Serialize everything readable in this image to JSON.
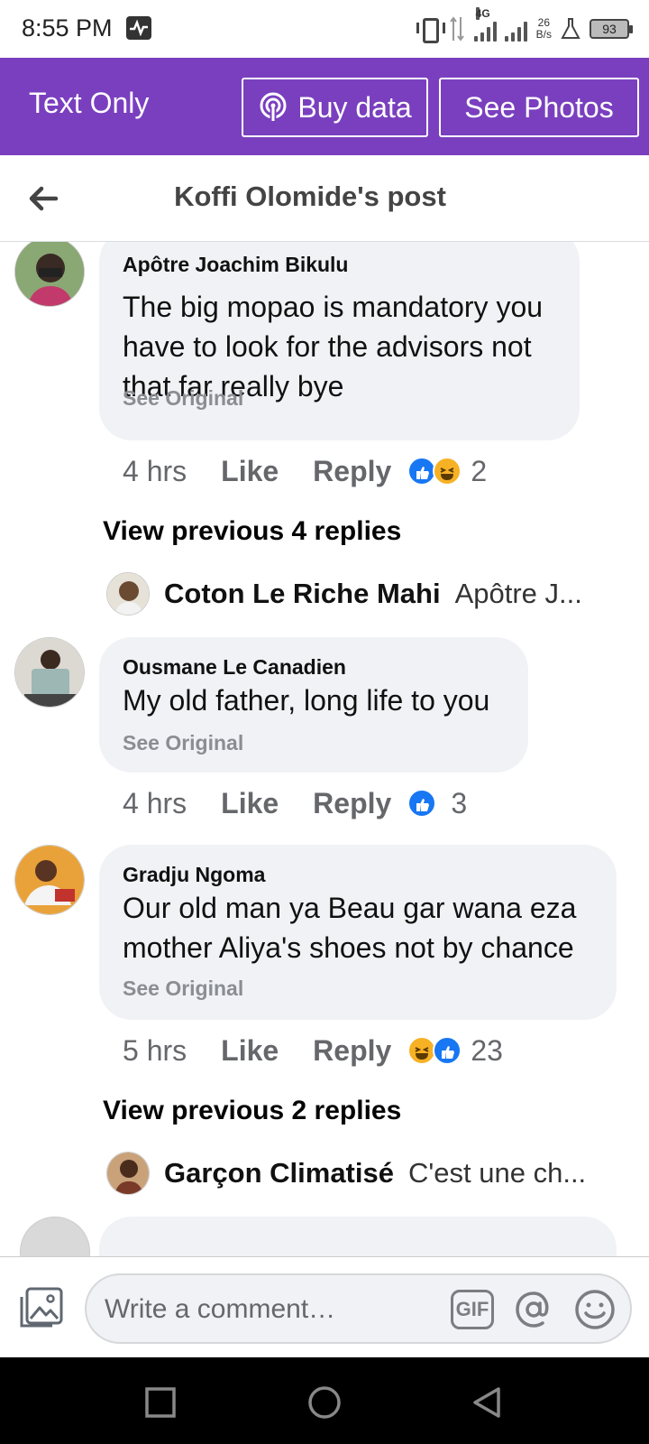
{
  "status_bar": {
    "time": "8:55 PM",
    "network": "4G",
    "speed_value": "26",
    "speed_unit": "B/s",
    "battery": "93"
  },
  "banner": {
    "title": "Text Only",
    "buy_data": "Buy data",
    "see_photos": "See Photos",
    "color": "#7a3fbf"
  },
  "header": {
    "title": "Koffi Olomide's post"
  },
  "comments": [
    {
      "author": "Apôtre Joachim Bikulu",
      "text_lines": [
        "The big mopao is mandatory you",
        "have to look for the advisors not",
        "that far really bye"
      ],
      "see_original": "See Original",
      "time": "4 hrs",
      "like": "Like",
      "reply": "Reply",
      "reactions": [
        "like",
        "haha"
      ],
      "count": "2"
    },
    {
      "author": "Ousmane Le Canadien",
      "text_lines": [
        "My old father, long life to you"
      ],
      "see_original": "See Original",
      "time": "4 hrs",
      "like": "Like",
      "reply": "Reply",
      "reactions": [
        "like"
      ],
      "count": "3"
    },
    {
      "author": "Gradju Ngoma",
      "text_lines": [
        "Our old man ya Beau gar wana eza",
        "mother Aliya's shoes not by chance"
      ],
      "see_original": "See Original",
      "time": "5 hrs",
      "like": "Like",
      "reply": "Reply",
      "reactions": [
        "haha",
        "like"
      ],
      "count": "23"
    }
  ],
  "reply_previews": [
    {
      "view_previous": "View previous 4 replies",
      "name": "Coton Le Riche Mahi",
      "text": "Apôtre J..."
    },
    {
      "view_previous": "View previous 2 replies",
      "name": "Garçon Climatisé",
      "text": "C'est une ch..."
    }
  ],
  "composer": {
    "placeholder": "Write a comment…",
    "gif": "GIF"
  },
  "icons": {
    "back": "arrow-left-icon",
    "buy_data": "hotspot-icon",
    "gallery": "photo-gallery-icon",
    "at": "at-sign-icon",
    "emoji": "smiley-icon",
    "nav": [
      "square-recents-icon",
      "circle-home-icon",
      "triangle-back-icon"
    ]
  }
}
